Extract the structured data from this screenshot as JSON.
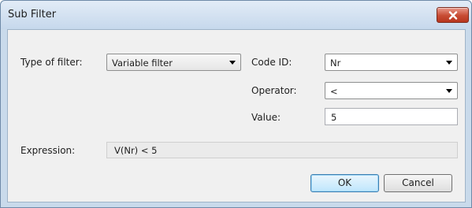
{
  "window": {
    "title": "Sub Filter"
  },
  "form": {
    "type_of_filter": {
      "label": "Type of filter:",
      "value": "Variable filter"
    },
    "code_id": {
      "label": "Code ID:",
      "value": "Nr"
    },
    "operator": {
      "label": "Operator:",
      "value": "<"
    },
    "value_field": {
      "label": "Value:",
      "value": "5"
    },
    "expression": {
      "label": "Expression:",
      "value": "V(Nr) < 5"
    }
  },
  "buttons": {
    "ok": "OK",
    "cancel": "Cancel"
  },
  "icons": {
    "close": "close-icon",
    "dropdown": "chevron-down-icon"
  },
  "colors": {
    "close_button": "#c74b33",
    "titlebar": "#c6d8ec",
    "client_bg": "#f0f0f0"
  }
}
